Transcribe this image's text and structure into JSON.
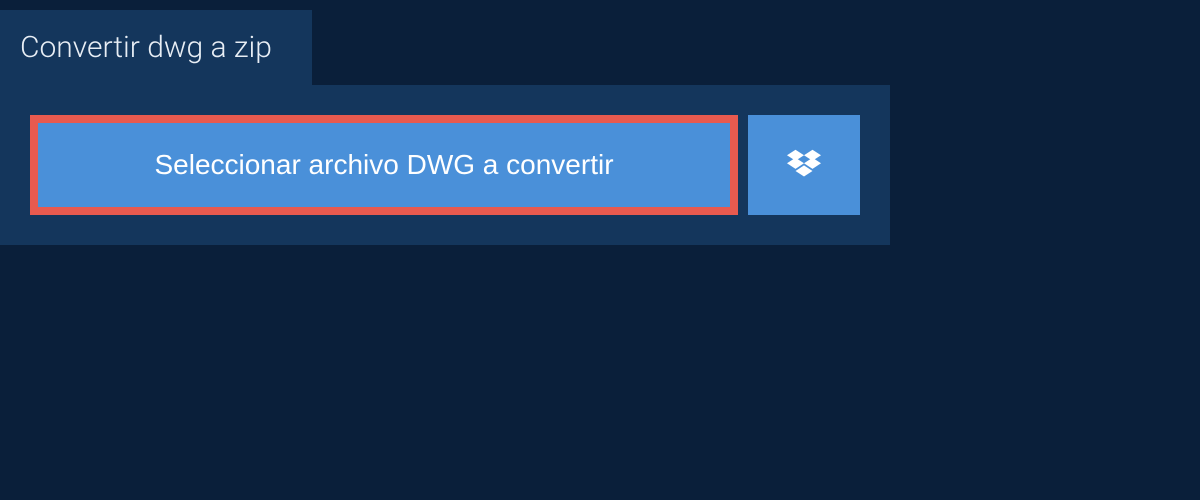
{
  "tab": {
    "title": "Convertir dwg a zip"
  },
  "actions": {
    "select_file_label": "Seleccionar archivo DWG a convertir"
  },
  "colors": {
    "page_bg": "#0a1f3a",
    "panel_bg": "#14365c",
    "button_bg": "#4a90d9",
    "highlight_border": "#e85a4f",
    "text_light": "#ffffff"
  }
}
